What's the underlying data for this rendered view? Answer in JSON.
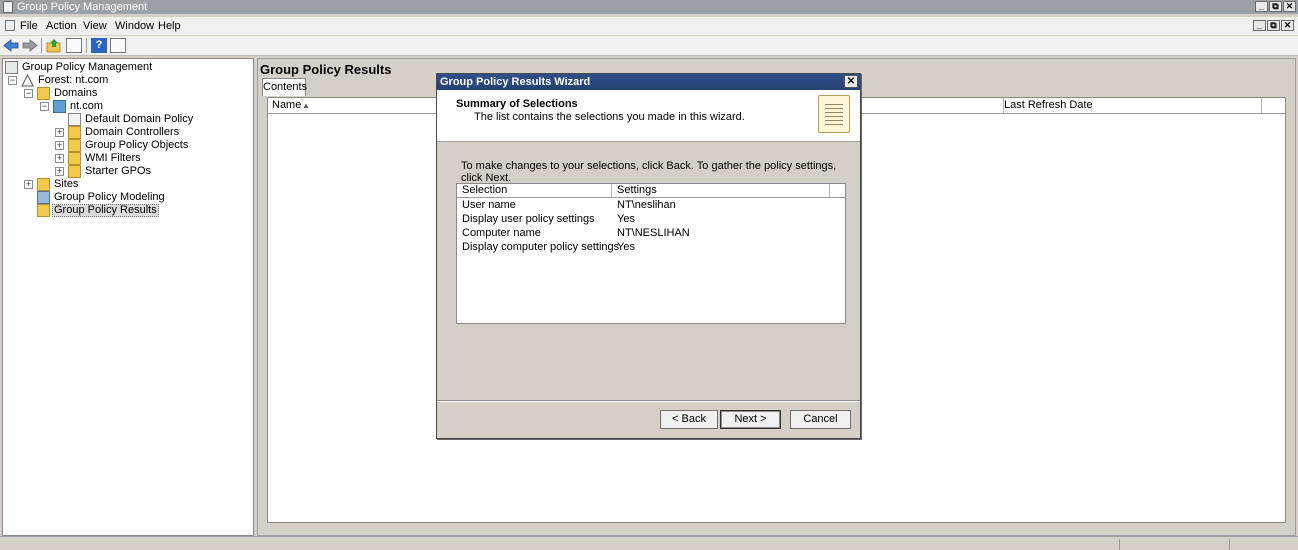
{
  "window": {
    "title": "Group Policy Management"
  },
  "menu": {
    "items": [
      "File",
      "Action",
      "View",
      "Window",
      "Help"
    ]
  },
  "toolbar": {
    "icons": [
      "back-arrow-icon",
      "forward-arrow-icon",
      "up-level-icon",
      "show-hide-tree-icon",
      "help-icon",
      "properties-icon"
    ]
  },
  "tree": {
    "items": [
      {
        "label": "Group Policy Management",
        "icon": "gpm-icon"
      },
      {
        "label": "Forest: nt.com",
        "icon": "forest-icon"
      },
      {
        "label": "Domains",
        "icon": "domains-icon"
      },
      {
        "label": "nt.com",
        "icon": "domain-icon"
      },
      {
        "label": "Default Domain Policy",
        "icon": "policy-icon"
      },
      {
        "label": "Domain Controllers",
        "icon": "ou-icon"
      },
      {
        "label": "Group Policy Objects",
        "icon": "folder-icon"
      },
      {
        "label": "WMI Filters",
        "icon": "folder-icon"
      },
      {
        "label": "Starter GPOs",
        "icon": "folder-icon"
      },
      {
        "label": "Sites",
        "icon": "sites-icon"
      },
      {
        "label": "Group Policy Modeling",
        "icon": "modeling-icon"
      },
      {
        "label": "Group Policy Results",
        "icon": "results-icon",
        "selected": true
      }
    ]
  },
  "right_pane": {
    "title": "Group Policy Results",
    "tab": "Contents",
    "columns": [
      "Name",
      "Last Refresh Date"
    ]
  },
  "dialog": {
    "title": "Group Policy Results Wizard",
    "header_title": "Summary of Selections",
    "header_subtitle": "The list contains the selections you made in this wizard.",
    "instruction": "To make changes to your selections, click Back. To gather the policy settings, click Next.",
    "table": {
      "columns": [
        "Selection",
        "Settings"
      ],
      "rows": [
        [
          "User name",
          "NT\\neslihan"
        ],
        [
          "Display user policy settings",
          "Yes"
        ],
        [
          "Computer name",
          "NT\\NESLIHAN"
        ],
        [
          "Display computer policy settings",
          "Yes"
        ]
      ]
    },
    "buttons": {
      "back": "< Back",
      "next": "Next >",
      "cancel": "Cancel"
    }
  }
}
